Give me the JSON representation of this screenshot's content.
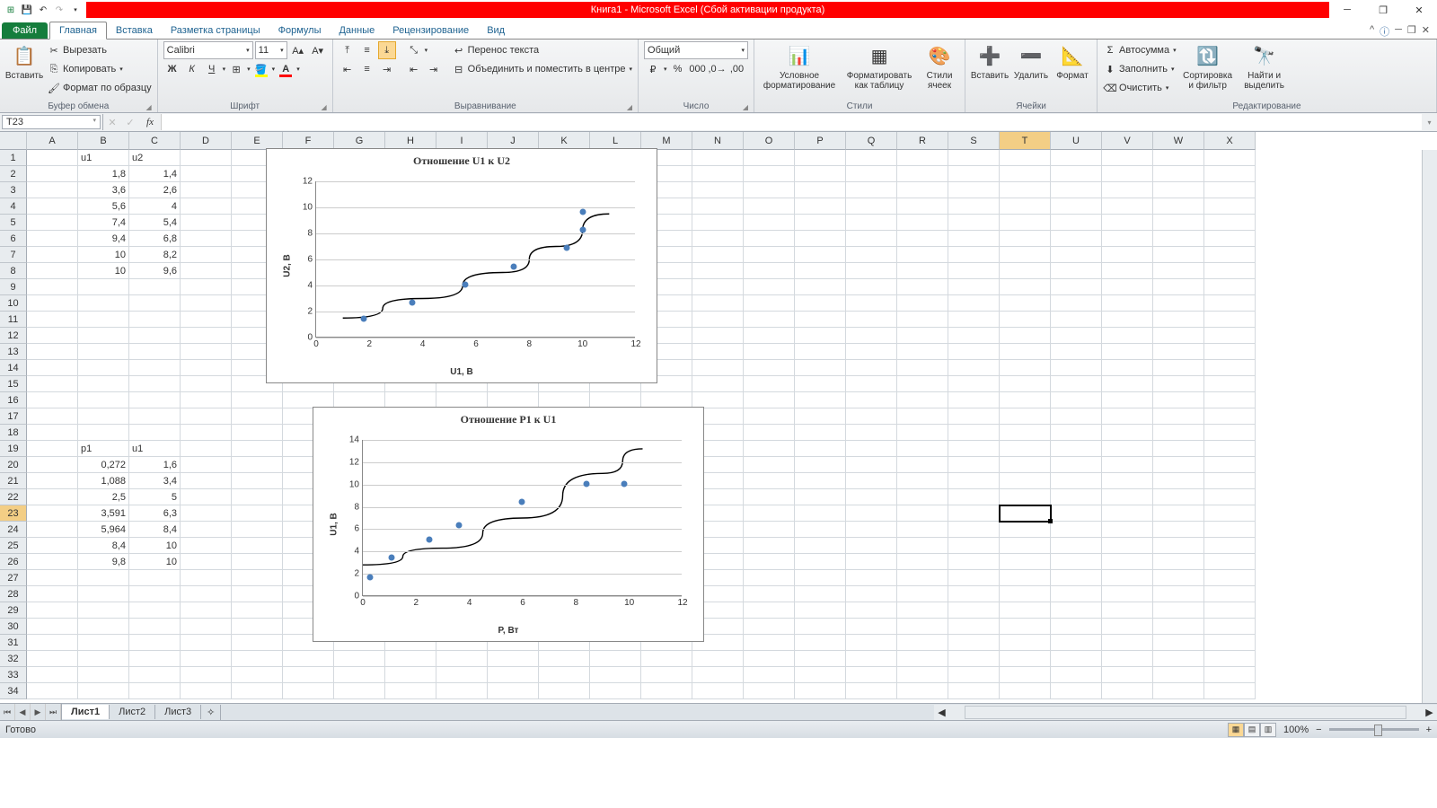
{
  "title": "Книга1 - Microsoft Excel (Сбой активации продукта)",
  "tabs": {
    "file": "Файл",
    "home": "Главная",
    "insert": "Вставка",
    "layout": "Разметка страницы",
    "formulas": "Формулы",
    "data": "Данные",
    "review": "Рецензирование",
    "view": "Вид"
  },
  "ribbon": {
    "clipboard": {
      "label": "Буфер обмена",
      "paste": "Вставить",
      "cut": "Вырезать",
      "copy": "Копировать",
      "format": "Формат по образцу"
    },
    "font": {
      "label": "Шрифт",
      "name": "Calibri",
      "size": "11"
    },
    "align": {
      "label": "Выравнивание",
      "wrap": "Перенос текста",
      "merge": "Объединить и поместить в центре"
    },
    "number": {
      "label": "Число",
      "fmt": "Общий"
    },
    "styles": {
      "label": "Стили",
      "cond": "Условное форматирование",
      "table": "Форматировать как таблицу",
      "cell": "Стили ячеек"
    },
    "cells": {
      "label": "Ячейки",
      "insert": "Вставить",
      "delete": "Удалить",
      "format": "Формат"
    },
    "edit": {
      "label": "Редактирование",
      "sum": "Автосумма",
      "fill": "Заполнить",
      "clear": "Очистить",
      "sort": "Сортировка и фильтр",
      "find": "Найти и выделить"
    }
  },
  "namebox": "T23",
  "columns": [
    "A",
    "B",
    "C",
    "D",
    "E",
    "F",
    "G",
    "H",
    "I",
    "J",
    "K",
    "L",
    "M",
    "N",
    "O",
    "P",
    "Q",
    "R",
    "S",
    "T",
    "U",
    "V",
    "W",
    "X"
  ],
  "active_col_idx": 19,
  "active_row_idx": 22,
  "table1": {
    "hdr": {
      "b": "u1",
      "c": "u2"
    },
    "rows": [
      {
        "b": "1,8",
        "c": "1,4"
      },
      {
        "b": "3,6",
        "c": "2,6"
      },
      {
        "b": "5,6",
        "c": "4"
      },
      {
        "b": "7,4",
        "c": "5,4"
      },
      {
        "b": "9,4",
        "c": "6,8"
      },
      {
        "b": "10",
        "c": "8,2"
      },
      {
        "b": "10",
        "c": "9,6"
      }
    ]
  },
  "table2": {
    "hdr": {
      "b": "p1",
      "c": "u1"
    },
    "rows": [
      {
        "b": "0,272",
        "c": "1,6"
      },
      {
        "b": "1,088",
        "c": "3,4"
      },
      {
        "b": "2,5",
        "c": "5"
      },
      {
        "b": "3,591",
        "c": "6,3"
      },
      {
        "b": "5,964",
        "c": "8,4"
      },
      {
        "b": "8,4",
        "c": "10"
      },
      {
        "b": "9,8",
        "c": "10"
      }
    ]
  },
  "chart_data": [
    {
      "type": "scatter",
      "title": "Отношение U1 к U2",
      "xlabel": "U1, В",
      "ylabel": "U2, В",
      "xlim": [
        0,
        12
      ],
      "ylim": [
        0,
        12
      ],
      "xticks": [
        0,
        2,
        4,
        6,
        8,
        10,
        12
      ],
      "yticks": [
        0,
        2,
        4,
        6,
        8,
        10,
        12
      ],
      "x": [
        1.8,
        3.6,
        5.6,
        7.4,
        9.4,
        10,
        10
      ],
      "y": [
        1.4,
        2.6,
        4.0,
        5.4,
        6.8,
        8.2,
        9.6
      ],
      "trend": [
        [
          1,
          1.5
        ],
        [
          4,
          3.0
        ],
        [
          7,
          5.0
        ],
        [
          9,
          7.0
        ],
        [
          11,
          9.5
        ]
      ]
    },
    {
      "type": "scatter",
      "title": "Отношение P1 к U1",
      "xlabel": "P, Вт",
      "ylabel": "U1, В",
      "xlim": [
        0,
        12
      ],
      "ylim": [
        0,
        14
      ],
      "xticks": [
        0,
        2,
        4,
        6,
        8,
        10,
        12
      ],
      "yticks": [
        0,
        2,
        4,
        6,
        8,
        10,
        12,
        14
      ],
      "x": [
        0.272,
        1.088,
        2.5,
        3.591,
        5.964,
        8.4,
        9.8
      ],
      "y": [
        1.6,
        3.4,
        5.0,
        6.3,
        8.4,
        10,
        10
      ],
      "trend": [
        [
          0,
          2.8
        ],
        [
          3,
          4.3
        ],
        [
          6,
          7.0
        ],
        [
          9,
          11.0
        ],
        [
          10.5,
          13.2
        ]
      ]
    }
  ],
  "sheets": {
    "s1": "Лист1",
    "s2": "Лист2",
    "s3": "Лист3"
  },
  "status": {
    "ready": "Готово",
    "zoom": "100%"
  }
}
